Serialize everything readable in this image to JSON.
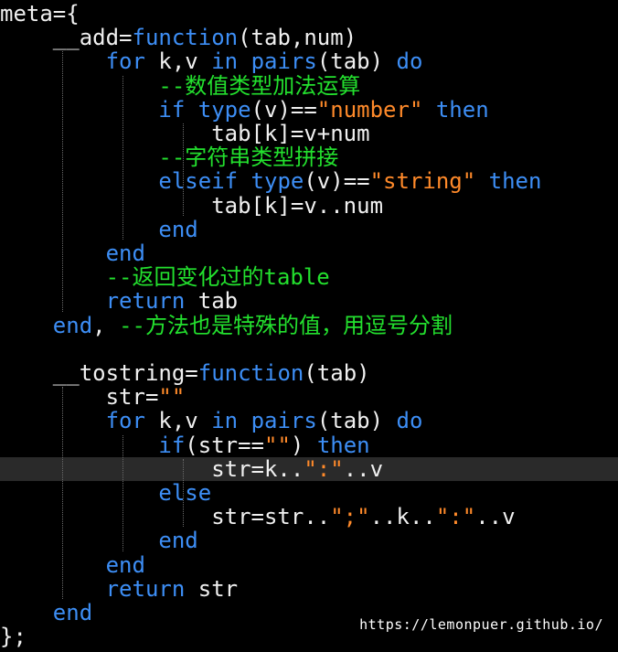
{
  "colors": {
    "default": "#f0f0f0",
    "keyword": "#3d8ef5",
    "string": "#ff8a2a",
    "comment": "#23e02e",
    "background": "#000000",
    "cursor_line": "#2a2a2a"
  },
  "editor": {
    "cursor_line_index": 19,
    "lines": [
      [
        {
          "t": "meta={",
          "c": "default"
        }
      ],
      [
        {
          "t": "    __add=",
          "c": "default"
        },
        {
          "t": "function",
          "c": "keyword"
        },
        {
          "t": "(tab,num)",
          "c": "default"
        }
      ],
      [
        {
          "t": "        ",
          "c": "default"
        },
        {
          "t": "for",
          "c": "keyword"
        },
        {
          "t": " k,v ",
          "c": "default"
        },
        {
          "t": "in",
          "c": "keyword"
        },
        {
          "t": " ",
          "c": "default"
        },
        {
          "t": "pairs",
          "c": "keyword"
        },
        {
          "t": "(tab) ",
          "c": "default"
        },
        {
          "t": "do",
          "c": "keyword"
        }
      ],
      [
        {
          "t": "            ",
          "c": "default"
        },
        {
          "t": "--数值类型加法运算",
          "c": "comment"
        }
      ],
      [
        {
          "t": "            ",
          "c": "default"
        },
        {
          "t": "if",
          "c": "keyword"
        },
        {
          "t": " ",
          "c": "default"
        },
        {
          "t": "type",
          "c": "keyword"
        },
        {
          "t": "(v)==",
          "c": "default"
        },
        {
          "t": "\"number\"",
          "c": "string"
        },
        {
          "t": " ",
          "c": "default"
        },
        {
          "t": "then",
          "c": "keyword"
        }
      ],
      [
        {
          "t": "                tab[k]=v+num",
          "c": "default"
        }
      ],
      [
        {
          "t": "            ",
          "c": "default"
        },
        {
          "t": "--字符串类型拼接",
          "c": "comment"
        }
      ],
      [
        {
          "t": "            ",
          "c": "default"
        },
        {
          "t": "elseif",
          "c": "keyword"
        },
        {
          "t": " ",
          "c": "default"
        },
        {
          "t": "type",
          "c": "keyword"
        },
        {
          "t": "(v)==",
          "c": "default"
        },
        {
          "t": "\"string\"",
          "c": "string"
        },
        {
          "t": " ",
          "c": "default"
        },
        {
          "t": "then",
          "c": "keyword"
        }
      ],
      [
        {
          "t": "                tab[k]=v..num",
          "c": "default"
        }
      ],
      [
        {
          "t": "            ",
          "c": "default"
        },
        {
          "t": "end",
          "c": "keyword"
        }
      ],
      [
        {
          "t": "        ",
          "c": "default"
        },
        {
          "t": "end",
          "c": "keyword"
        }
      ],
      [
        {
          "t": "        ",
          "c": "default"
        },
        {
          "t": "--返回变化过的table",
          "c": "comment"
        }
      ],
      [
        {
          "t": "        ",
          "c": "default"
        },
        {
          "t": "return",
          "c": "keyword"
        },
        {
          "t": " tab",
          "c": "default"
        }
      ],
      [
        {
          "t": "    ",
          "c": "default"
        },
        {
          "t": "end",
          "c": "keyword"
        },
        {
          "t": ", ",
          "c": "default"
        },
        {
          "t": "--方法也是特殊的值，用逗号分割",
          "c": "comment"
        }
      ],
      [
        {
          "t": "",
          "c": "default"
        }
      ],
      [
        {
          "t": "    __tostring=",
          "c": "default"
        },
        {
          "t": "function",
          "c": "keyword"
        },
        {
          "t": "(tab)",
          "c": "default"
        }
      ],
      [
        {
          "t": "        str=",
          "c": "default"
        },
        {
          "t": "\"\"",
          "c": "string"
        }
      ],
      [
        {
          "t": "        ",
          "c": "default"
        },
        {
          "t": "for",
          "c": "keyword"
        },
        {
          "t": " k,v ",
          "c": "default"
        },
        {
          "t": "in",
          "c": "keyword"
        },
        {
          "t": " ",
          "c": "default"
        },
        {
          "t": "pairs",
          "c": "keyword"
        },
        {
          "t": "(tab) ",
          "c": "default"
        },
        {
          "t": "do",
          "c": "keyword"
        }
      ],
      [
        {
          "t": "            ",
          "c": "default"
        },
        {
          "t": "if",
          "c": "keyword"
        },
        {
          "t": "(str==",
          "c": "default"
        },
        {
          "t": "\"\"",
          "c": "string"
        },
        {
          "t": ") ",
          "c": "default"
        },
        {
          "t": "then",
          "c": "keyword"
        }
      ],
      [
        {
          "t": "                str=k..",
          "c": "default"
        },
        {
          "t": "\":\"",
          "c": "string"
        },
        {
          "t": "..v",
          "c": "default"
        }
      ],
      [
        {
          "t": "            ",
          "c": "default"
        },
        {
          "t": "else",
          "c": "keyword"
        }
      ],
      [
        {
          "t": "                str=str..",
          "c": "default"
        },
        {
          "t": "\";\"",
          "c": "string"
        },
        {
          "t": "..k..",
          "c": "default"
        },
        {
          "t": "\":\"",
          "c": "string"
        },
        {
          "t": "..v",
          "c": "default"
        }
      ],
      [
        {
          "t": "            ",
          "c": "default"
        },
        {
          "t": "end",
          "c": "keyword"
        }
      ],
      [
        {
          "t": "        ",
          "c": "default"
        },
        {
          "t": "end",
          "c": "keyword"
        }
      ],
      [
        {
          "t": "        ",
          "c": "default"
        },
        {
          "t": "return",
          "c": "keyword"
        },
        {
          "t": " str",
          "c": "default"
        }
      ],
      [
        {
          "t": "    ",
          "c": "default"
        },
        {
          "t": "end",
          "c": "keyword"
        }
      ],
      [
        {
          "t": "};",
          "c": "default"
        }
      ]
    ]
  },
  "watermark": "https://lemonpuer.github.io/"
}
